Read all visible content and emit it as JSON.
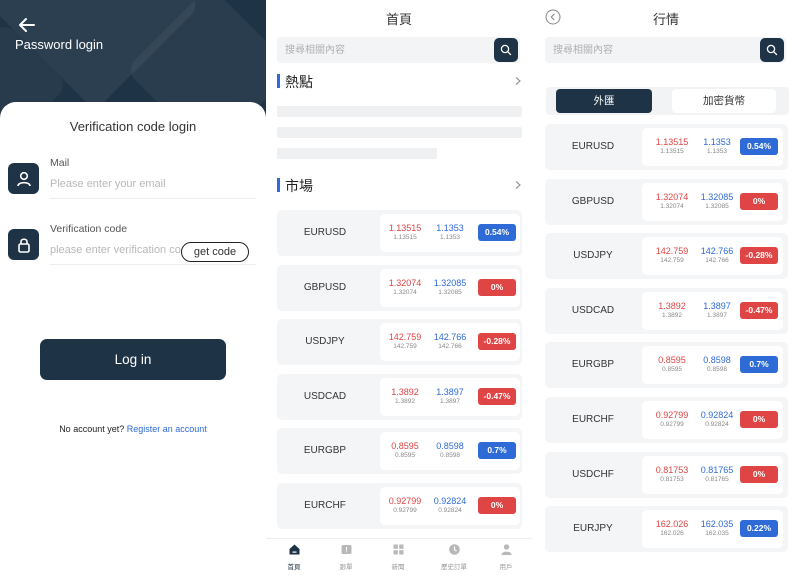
{
  "login": {
    "back_icon": "arrow-left-icon",
    "hero_title": "Password login",
    "card_title": "Verification code login",
    "mail_label": "Mail",
    "mail_placeholder": "Please enter your email",
    "code_label": "Verification code",
    "code_placeholder": "please enter verification code",
    "getcode_label": "get code",
    "login_label": "Log in",
    "no_account_text": "No account yet?",
    "register_link": "Register an account",
    "colors": {
      "primary": "#1f3346",
      "link": "#2e6bd6"
    }
  },
  "home": {
    "title": "首頁",
    "search_placeholder": "搜尋相關內容",
    "hot_title": "熱點",
    "market_title": "市場",
    "quotes": [
      {
        "symbol": "EURUSD",
        "bid": "1.13515",
        "bid_small": "1.13515",
        "ask": "1.1353",
        "ask_small": "1.1353",
        "change": "0.54%",
        "dir": "up"
      },
      {
        "symbol": "GBPUSD",
        "bid": "1.32074",
        "bid_small": "1.32074",
        "ask": "1.32085",
        "ask_small": "1.32085",
        "change": "0%",
        "dir": "down"
      },
      {
        "symbol": "USDJPY",
        "bid": "142.759",
        "bid_small": "142.759",
        "ask": "142.766",
        "ask_small": "142.766",
        "change": "-0.28%",
        "dir": "down"
      },
      {
        "symbol": "USDCAD",
        "bid": "1.3892",
        "bid_small": "1.3892",
        "ask": "1.3897",
        "ask_small": "1.3897",
        "change": "-0.47%",
        "dir": "down"
      },
      {
        "symbol": "EURGBP",
        "bid": "0.8595",
        "bid_small": "0.8595",
        "ask": "0.8598",
        "ask_small": "0.8598",
        "change": "0.7%",
        "dir": "up"
      },
      {
        "symbol": "EURCHF",
        "bid": "0.92799",
        "bid_small": "0.92799",
        "ask": "0.92824",
        "ask_small": "0.92824",
        "change": "0%",
        "dir": "down"
      }
    ],
    "nav": [
      {
        "label": "首頁",
        "icon": "home-icon",
        "active": true
      },
      {
        "label": "跟單",
        "icon": "copy-trade-icon",
        "active": false
      },
      {
        "label": "新聞",
        "icon": "news-grid-icon",
        "active": false
      },
      {
        "label": "歷史訂單",
        "icon": "history-clock-icon",
        "active": false
      },
      {
        "label": "用戶",
        "icon": "user-icon",
        "active": false
      }
    ]
  },
  "market": {
    "title": "行情",
    "back_icon": "circle-back-icon",
    "search_placeholder": "搜尋相關內容",
    "tabs": [
      "外匯",
      "加密貨幣"
    ],
    "quotes": [
      {
        "symbol": "EURUSD",
        "bid": "1.13515",
        "bid_small": "1.13515",
        "ask": "1.1353",
        "ask_small": "1.1353",
        "change": "0.54%",
        "dir": "up"
      },
      {
        "symbol": "GBPUSD",
        "bid": "1.32074",
        "bid_small": "1.32074",
        "ask": "1.32085",
        "ask_small": "1.32085",
        "change": "0%",
        "dir": "down"
      },
      {
        "symbol": "USDJPY",
        "bid": "142.759",
        "bid_small": "142.759",
        "ask": "142.766",
        "ask_small": "142.766",
        "change": "-0.28%",
        "dir": "down"
      },
      {
        "symbol": "USDCAD",
        "bid": "1.3892",
        "bid_small": "1.3892",
        "ask": "1.3897",
        "ask_small": "1.3897",
        "change": "-0.47%",
        "dir": "down"
      },
      {
        "symbol": "EURGBP",
        "bid": "0.8595",
        "bid_small": "0.8595",
        "ask": "0.8598",
        "ask_small": "0.8598",
        "change": "0.7%",
        "dir": "up"
      },
      {
        "symbol": "EURCHF",
        "bid": "0.92799",
        "bid_small": "0.92799",
        "ask": "0.92824",
        "ask_small": "0.92824",
        "change": "0%",
        "dir": "down"
      },
      {
        "symbol": "USDCHF",
        "bid": "0.81753",
        "bid_small": "0.81753",
        "ask": "0.81765",
        "ask_small": "0.81765",
        "change": "0%",
        "dir": "down"
      },
      {
        "symbol": "EURJPY",
        "bid": "162.026",
        "bid_small": "162.026",
        "ask": "162.035",
        "ask_small": "162.035",
        "change": "0.22%",
        "dir": "up"
      }
    ]
  },
  "colors": {
    "up": "#2e6bd6",
    "down": "#e04545",
    "card_bg": "#f4f5f7"
  }
}
